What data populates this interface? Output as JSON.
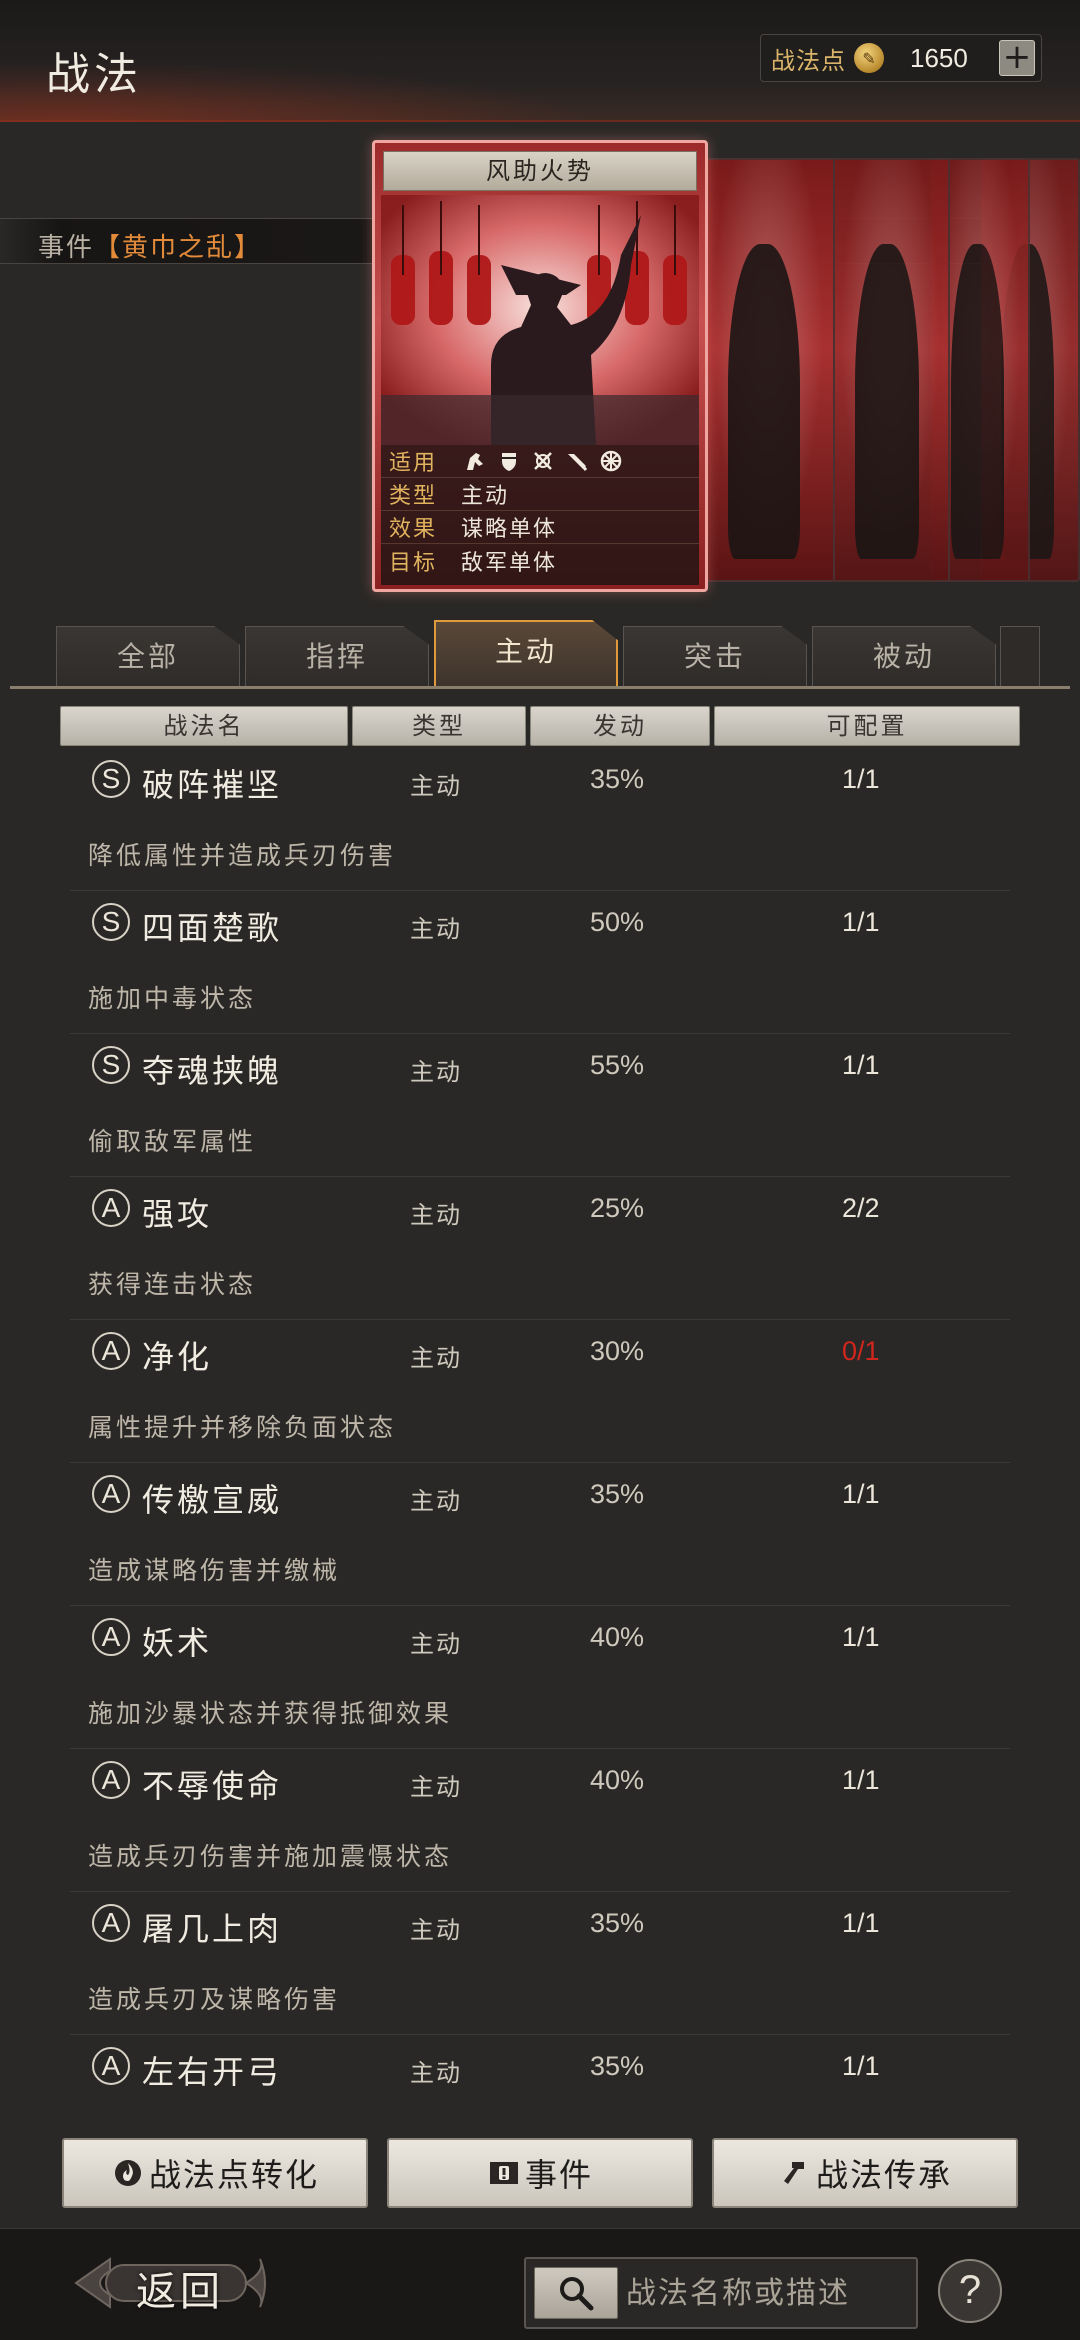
{
  "header": {
    "title": "战法",
    "points_label": "战法点",
    "points_value": "1650",
    "plus_symbol": "+"
  },
  "event": {
    "prefix": "事件",
    "name": "【黄巾之乱】"
  },
  "card": {
    "title": "风助火势",
    "rows": [
      {
        "key": "适用",
        "value": ""
      },
      {
        "key": "类型",
        "value": "主动"
      },
      {
        "key": "效果",
        "value": "谋略单体"
      },
      {
        "key": "目标",
        "value": "敌军单体"
      }
    ],
    "unit_icons": [
      "cavalry-icon",
      "shield-icon",
      "crossbow-icon",
      "spear-icon",
      "siege-icon"
    ]
  },
  "tabs": [
    {
      "label": "全部",
      "active": false
    },
    {
      "label": "指挥",
      "active": false
    },
    {
      "label": "主动",
      "active": true
    },
    {
      "label": "突击",
      "active": false
    },
    {
      "label": "被动",
      "active": false
    }
  ],
  "columns": [
    "战法名",
    "类型",
    "发动",
    "可配置"
  ],
  "skills": [
    {
      "grade": "S",
      "name": "破阵摧坚",
      "type": "主动",
      "rate": "35%",
      "count": "1/1",
      "desc": "降低属性并造成兵刃伤害",
      "alert": false
    },
    {
      "grade": "S",
      "name": "四面楚歌",
      "type": "主动",
      "rate": "50%",
      "count": "1/1",
      "desc": "施加中毒状态",
      "alert": false
    },
    {
      "grade": "S",
      "name": "夺魂挟魄",
      "type": "主动",
      "rate": "55%",
      "count": "1/1",
      "desc": "偷取敌军属性",
      "alert": false
    },
    {
      "grade": "A",
      "name": "强攻",
      "type": "主动",
      "rate": "25%",
      "count": "2/2",
      "desc": "获得连击状态",
      "alert": false
    },
    {
      "grade": "A",
      "name": "净化",
      "type": "主动",
      "rate": "30%",
      "count": "0/1",
      "desc": "属性提升并移除负面状态",
      "alert": true
    },
    {
      "grade": "A",
      "name": "传檄宣威",
      "type": "主动",
      "rate": "35%",
      "count": "1/1",
      "desc": "造成谋略伤害并缴械",
      "alert": false
    },
    {
      "grade": "A",
      "name": "妖术",
      "type": "主动",
      "rate": "40%",
      "count": "1/1",
      "desc": "施加沙暴状态并获得抵御效果",
      "alert": false
    },
    {
      "grade": "A",
      "name": "不辱使命",
      "type": "主动",
      "rate": "40%",
      "count": "1/1",
      "desc": "造成兵刃伤害并施加震慑状态",
      "alert": false
    },
    {
      "grade": "A",
      "name": "屠几上肉",
      "type": "主动",
      "rate": "35%",
      "count": "1/1",
      "desc": "造成兵刃及谋略伤害",
      "alert": false
    },
    {
      "grade": "A",
      "name": "左右开弓",
      "type": "主动",
      "rate": "35%",
      "count": "1/1",
      "desc": "",
      "alert": false
    }
  ],
  "actions": {
    "convert_label": "战法点转化",
    "event_label": "事件",
    "inherit_label": "战法传承"
  },
  "footer": {
    "back_label": "返回",
    "search_placeholder": "战法名称或描述",
    "help_symbol": "?"
  },
  "colors": {
    "accent_orange": "#e09a3c",
    "alert_red": "#d1261e",
    "gold_label": "#d9b46a"
  }
}
